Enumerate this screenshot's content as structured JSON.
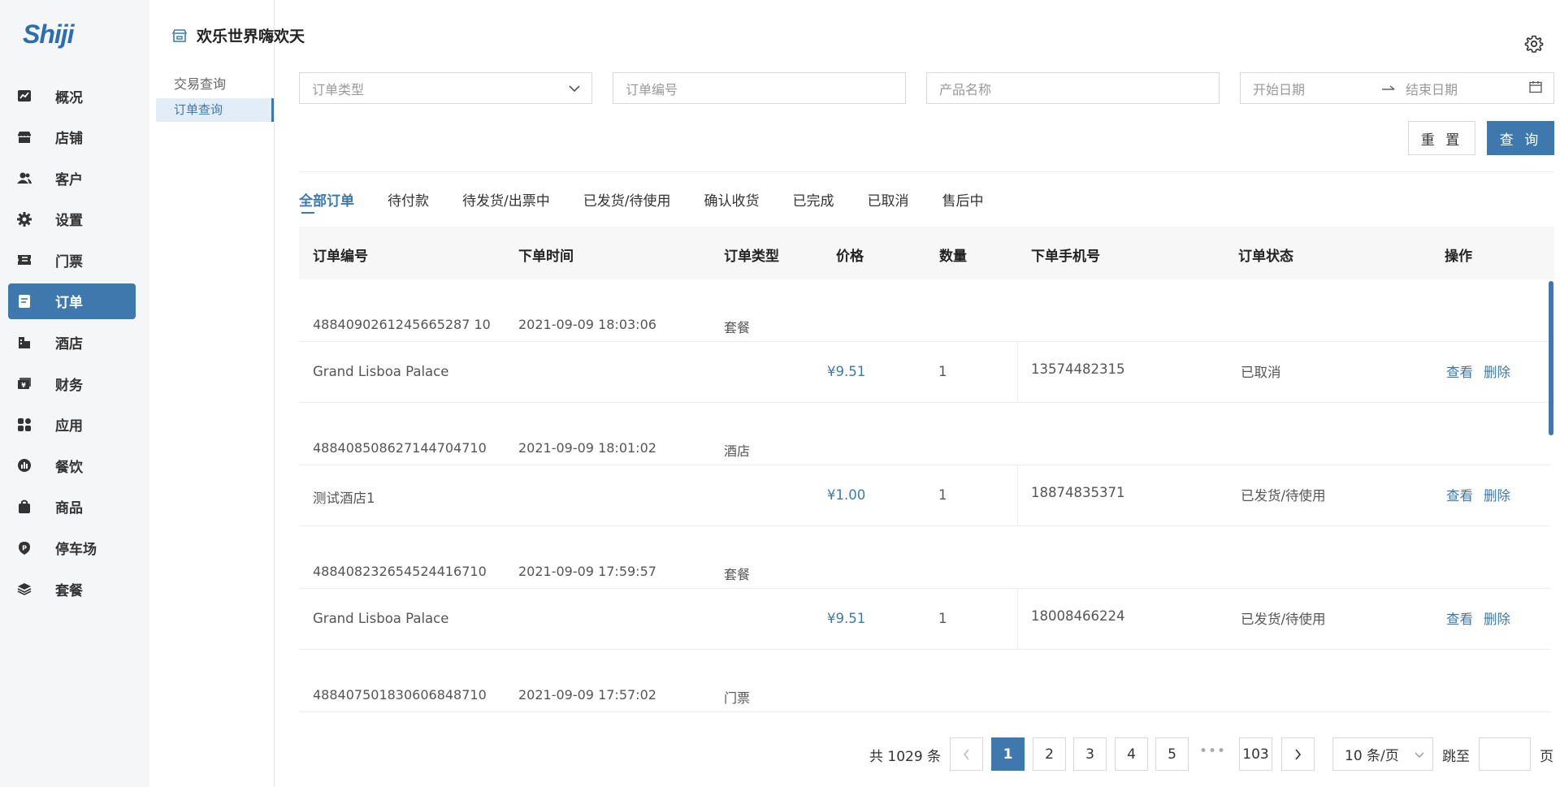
{
  "brand": {
    "logo_text": "Shiji"
  },
  "sidebar": {
    "items": [
      {
        "label": "概况",
        "icon": "chart-icon"
      },
      {
        "label": "店铺",
        "icon": "store-icon"
      },
      {
        "label": "客户",
        "icon": "users-icon"
      },
      {
        "label": "设置",
        "icon": "gear-icon"
      },
      {
        "label": "门票",
        "icon": "ticket-icon"
      },
      {
        "label": "订单",
        "icon": "order-icon",
        "active": true
      },
      {
        "label": "酒店",
        "icon": "hotel-icon"
      },
      {
        "label": "财务",
        "icon": "finance-icon"
      },
      {
        "label": "应用",
        "icon": "apps-icon"
      },
      {
        "label": "餐饮",
        "icon": "dining-icon"
      },
      {
        "label": "商品",
        "icon": "bag-icon"
      },
      {
        "label": "停车场",
        "icon": "parking-icon"
      },
      {
        "label": "套餐",
        "icon": "layers-icon"
      }
    ]
  },
  "subnav": {
    "shop_title": "欢乐世界嗨欢天",
    "group_label": "交易查询",
    "active_item": "订单查询"
  },
  "filters": {
    "order_type_placeholder": "订单类型",
    "order_no_placeholder": "订单编号",
    "product_name_placeholder": "产品名称",
    "start_date_placeholder": "开始日期",
    "end_date_placeholder": "结束日期",
    "reset_label": "重 置",
    "query_label": "查 询"
  },
  "tabs": [
    {
      "label": "全部订单",
      "active": true
    },
    {
      "label": "待付款"
    },
    {
      "label": "待发货/出票中"
    },
    {
      "label": "已发货/待使用"
    },
    {
      "label": "确认收货"
    },
    {
      "label": "已完成"
    },
    {
      "label": "已取消"
    },
    {
      "label": "售后中"
    }
  ],
  "table": {
    "headers": {
      "order_no": "订单编号",
      "order_time": "下单时间",
      "order_type": "订单类型",
      "price": "价格",
      "qty": "数量",
      "phone": "下单手机号",
      "status": "订单状态",
      "actions": "操作"
    },
    "orders": [
      {
        "order_no": "4884090261245665287 10",
        "order_time": "2021-09-09 18:03:06",
        "type": "套餐",
        "product": "Grand Lisboa Palace",
        "price": "¥9.51",
        "qty": "1",
        "phone": "13574482315",
        "status": "已取消",
        "view": "查看",
        "delete": "删除"
      },
      {
        "order_no": "488408508627144704710",
        "order_time": "2021-09-09 18:01:02",
        "type": "酒店",
        "product": "测试酒店1",
        "price": "¥1.00",
        "qty": "1",
        "phone": "18874835371",
        "status": "已发货/待使用",
        "view": "查看",
        "delete": "删除"
      },
      {
        "order_no": "488408232654524416710",
        "order_time": "2021-09-09 17:59:57",
        "type": "套餐",
        "product": "Grand Lisboa Palace",
        "price": "¥9.51",
        "qty": "1",
        "phone": "18008466224",
        "status": "已发货/待使用",
        "view": "查看",
        "delete": "删除"
      },
      {
        "order_no": "488407501830606848710",
        "order_time": "2021-09-09 17:57:02",
        "type": "门票"
      }
    ]
  },
  "pagination": {
    "total_text": "共 1029 条",
    "pages": [
      "1",
      "2",
      "3",
      "4",
      "5"
    ],
    "current": "1",
    "ellipsis": "•••",
    "last_page": "103",
    "page_size": "10 条/页",
    "jump_label": "跳至",
    "jump_value": "",
    "page_suffix": "页"
  },
  "colors": {
    "accent": "#3e78ac",
    "sidebar_bg": "#f5f6f8"
  }
}
